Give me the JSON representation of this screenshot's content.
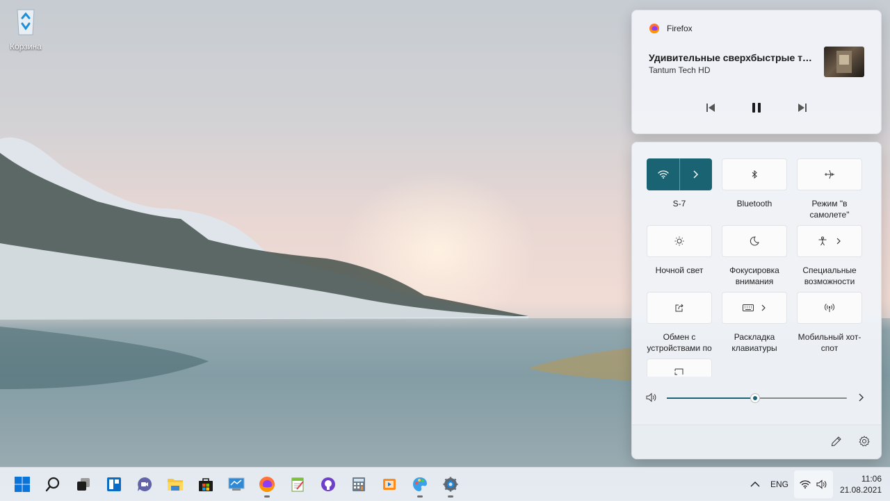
{
  "desktop": {
    "recycle_bin_label": "Корзина"
  },
  "media": {
    "app_name": "Firefox",
    "track_title": "Удивительные сверхбыстрые тока...",
    "artist": "Tantum Tech HD",
    "icons": {
      "app": "firefox-icon",
      "prev": "previous-track-icon",
      "pause": "pause-icon",
      "next": "next-track-icon"
    }
  },
  "quick_settings": {
    "tiles": [
      {
        "label": "S-7",
        "icon": "wifi-icon",
        "active": true,
        "expandable": true
      },
      {
        "label": "Bluetooth",
        "icon": "bluetooth-icon",
        "active": false
      },
      {
        "label": "Режим \"в самолете\"",
        "icon": "airplane-icon",
        "active": false
      },
      {
        "label": "Ночной свет",
        "icon": "brightness-icon",
        "active": false
      },
      {
        "label": "Фокусировка внимания",
        "icon": "moon-icon",
        "active": false
      },
      {
        "label": "Специальные возможности",
        "icon": "accessibility-icon",
        "active": false,
        "expandable": true
      },
      {
        "label": "Обмен с устройствами по",
        "icon": "share-icon",
        "active": false
      },
      {
        "label": "Раскладка клавиатуры",
        "icon": "keyboard-icon",
        "active": false,
        "expandable": true
      },
      {
        "label": "Мобильный хот-спот",
        "icon": "hotspot-icon",
        "active": false
      },
      {
        "label": "",
        "icon": "cast-icon",
        "active": false
      }
    ],
    "volume": {
      "level": 0.49,
      "icon": "speaker-icon"
    },
    "footer": {
      "edit_icon": "pencil-icon",
      "settings_icon": "gear-icon"
    }
  },
  "taskbar": {
    "apps": [
      "windows-start-icon",
      "search-icon",
      "task-view-icon",
      "widgets-icon",
      "teams-chat-icon",
      "file-explorer-icon",
      "store-icon",
      "control-panel-icon",
      "firefox-icon",
      "notepad-icon",
      "github-icon",
      "calculator-icon",
      "media-player-icon",
      "paint-icon",
      "settings-icon"
    ],
    "tray": {
      "language": "ENG",
      "time": "11:06",
      "date": "21.08.2021"
    }
  },
  "colors": {
    "accent": "#1a6373"
  }
}
